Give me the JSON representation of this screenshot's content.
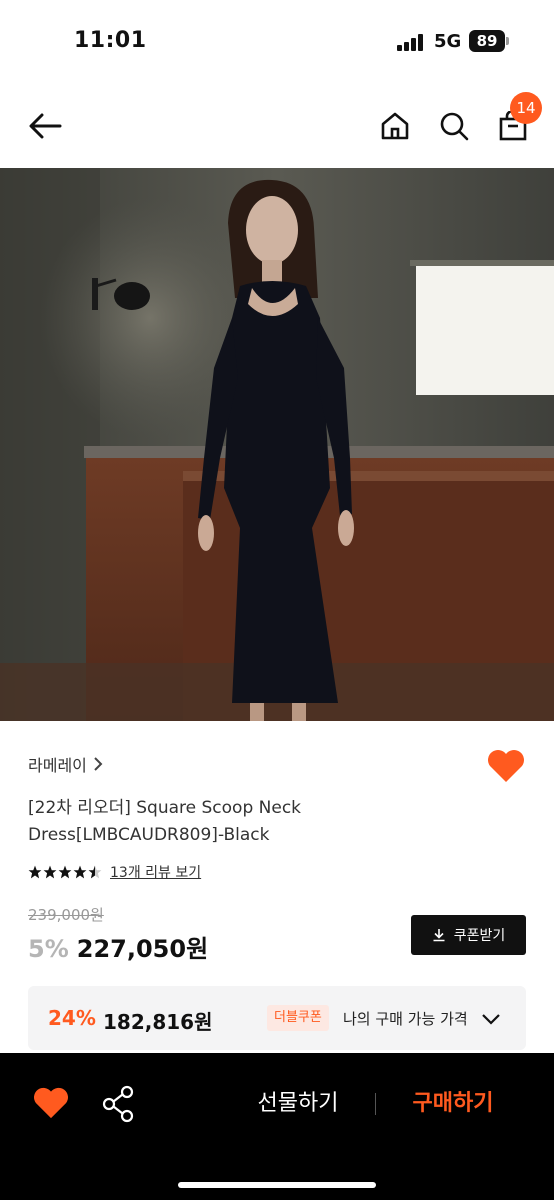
{
  "status_bar": {
    "time": "11:01",
    "network": "5G",
    "battery": "89"
  },
  "header": {
    "cart_count": "14"
  },
  "icons": {
    "back": "arrow-left-icon",
    "home": "home-icon",
    "search": "search-icon",
    "cart": "shopping-bag-icon",
    "like": "heart-icon",
    "share": "share-icon",
    "download": "download-icon",
    "chevron": "chevron-down-icon"
  },
  "product": {
    "brand": "라메레이",
    "title": "[22차 리오더] Square Scoop Neck Dress[LMBCAUDR809]-Black",
    "rating": 4.5,
    "review_link": "13개 리뷰 보기",
    "original_price": "239,000원",
    "discount": "5%",
    "sale_price": "227,050원",
    "coupon_button": "쿠폰받기"
  },
  "final_price": {
    "percent": "24%",
    "price": "182,816원",
    "badge": "더블쿠폰",
    "label": "나의 구매 가능 가격"
  },
  "action_bar": {
    "gift_label": "선물하기",
    "buy_label": "구매하기"
  },
  "colors": {
    "accent": "#ff5a1f",
    "dark": "#111111",
    "bar_bg": "#000000",
    "panel_bg": "#f4f4f5"
  }
}
